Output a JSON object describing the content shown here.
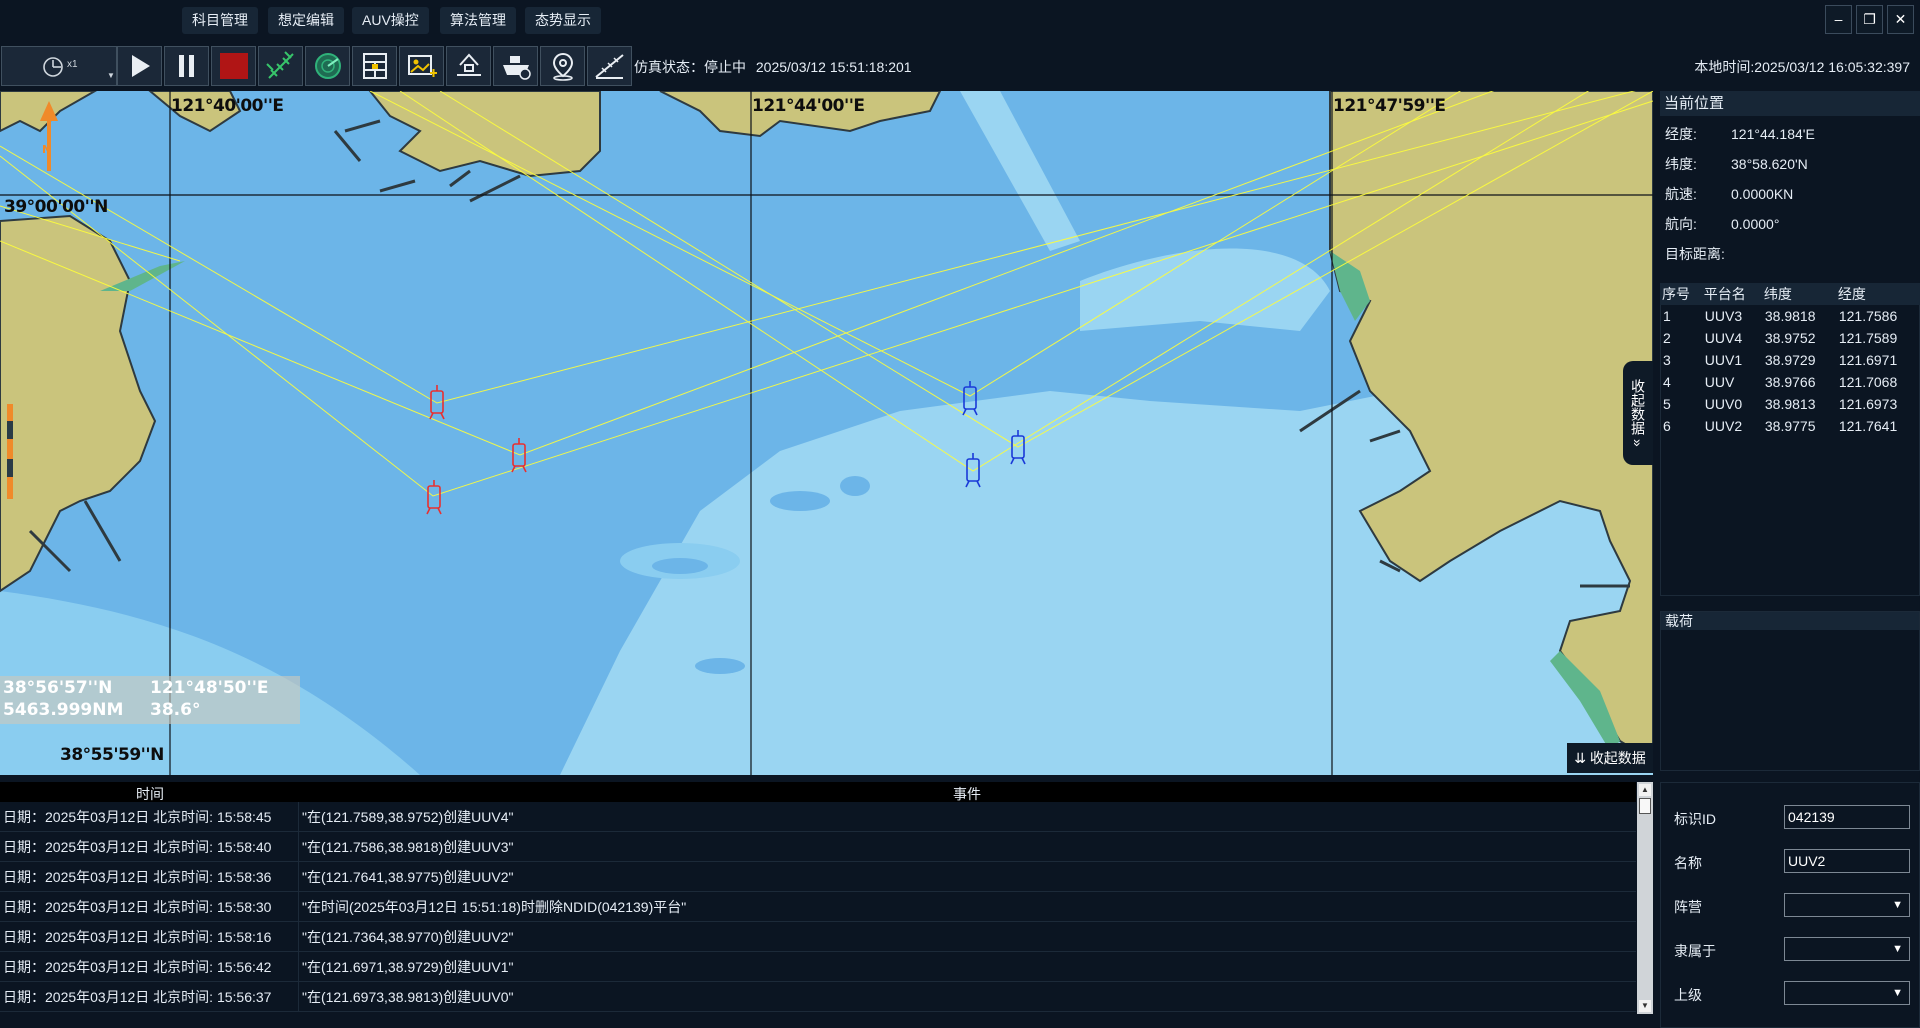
{
  "menu": {
    "items": [
      {
        "label": "科目管理"
      },
      {
        "label": "想定编辑"
      },
      {
        "label": "AUV操控"
      },
      {
        "label": "算法管理"
      },
      {
        "label": "态势显示"
      }
    ],
    "minimize": "–",
    "maximize": "❐",
    "close": "✕"
  },
  "toolbar": {
    "speed": "x1",
    "status_label": "仿真状态：",
    "status_value": "停止中",
    "sim_time": "2025/03/12 15:51:18:201",
    "local_time_label": "本地时间:",
    "local_time": "2025/03/12 16:05:32:397",
    "icons": [
      "speed-clock-icon",
      "play-icon",
      "pause-icon",
      "stop-icon",
      "satellite-icon",
      "radar-icon",
      "grid-table-icon",
      "add-image-icon",
      "ship-dock-icon",
      "vessel-icon",
      "location-pin-icon",
      "ruler-icon"
    ],
    "accent_colors": {
      "stop": "#b01515",
      "satellite": "#37c46a",
      "radar": "#2fb27a",
      "add_image": "#f0c200"
    }
  },
  "map": {
    "longitude_labels": [
      "121°40'00''E",
      "121°44'00''E",
      "121°47'59''E"
    ],
    "latitude_labels": [
      "39°00'00''N",
      "38°55'59''N"
    ],
    "cursor": {
      "lat": "38°56'57''N",
      "lon": "121°48'50''E",
      "range": "5463.999NM",
      "bearing": "38.6°"
    },
    "north_letter": "N",
    "collapse_bottom": "收起数据",
    "collapse_side": "收起数据",
    "colors": {
      "deep_water": "#6cb5e8",
      "shallow_water": "#9ad5f2",
      "land": "#cac47c",
      "coast_green": "#5fb58c",
      "track_line": "#ffff3a",
      "unit_red": "#e83030",
      "unit_blue": "#1a3ad8",
      "north_arrow": "#f08a2a"
    }
  },
  "right_panel": {
    "current_position": {
      "title": "当前位置",
      "rows": [
        {
          "key": "经度:",
          "value": "121°44.184'E"
        },
        {
          "key": "纬度:",
          "value": "38°58.620'N"
        },
        {
          "key": "航速:",
          "value": "0.0000KN"
        },
        {
          "key": "航向:",
          "value": "0.0000°"
        },
        {
          "key": "目标距离:",
          "value": ""
        }
      ]
    },
    "platforms": {
      "headers": [
        "序号",
        "平台名",
        "纬度",
        "经度"
      ],
      "rows": [
        [
          "1",
          "UUV3",
          "38.9818",
          "121.7586"
        ],
        [
          "2",
          "UUV4",
          "38.9752",
          "121.7589"
        ],
        [
          "3",
          "UUV1",
          "38.9729",
          "121.6971"
        ],
        [
          "4",
          "UUV",
          "38.9766",
          "121.7068"
        ],
        [
          "5",
          "UUV0",
          "38.9813",
          "121.6973"
        ],
        [
          "6",
          "UUV2",
          "38.9775",
          "121.7641"
        ]
      ]
    },
    "payload_title": "载荷"
  },
  "event_log": {
    "col_time": "时间",
    "col_event": "事件",
    "rows": [
      {
        "time": "日期：2025年03月12日 北京时间: 15:58:45",
        "event": "\"在(121.7589,38.9752)创建UUV4\""
      },
      {
        "time": "日期：2025年03月12日 北京时间: 15:58:40",
        "event": "\"在(121.7586,38.9818)创建UUV3\""
      },
      {
        "time": "日期：2025年03月12日 北京时间: 15:58:36",
        "event": "\"在(121.7641,38.9775)创建UUV2\""
      },
      {
        "time": "日期：2025年03月12日 北京时间: 15:58:30",
        "event": "\"在时间(2025年03月12日 15:51:18)时删除NDID(042139)平台\""
      },
      {
        "time": "日期：2025年03月12日 北京时间: 15:58:16",
        "event": "\"在(121.7364,38.9770)创建UUV2\""
      },
      {
        "time": "日期：2025年03月12日 北京时间: 15:56:42",
        "event": "\"在(121.6971,38.9729)创建UUV1\""
      },
      {
        "time": "日期：2025年03月12日 北京时间: 15:56:37",
        "event": "\"在(121.6973,38.9813)创建UUV0\""
      }
    ]
  },
  "properties": {
    "id_label": "标识ID",
    "id_value": "042139",
    "name_label": "名称",
    "name_value": "UUV2",
    "camp_label": "阵营",
    "belongs_label": "隶属于",
    "parent_label": "上级",
    "dropdown_arrow": "▼"
  }
}
